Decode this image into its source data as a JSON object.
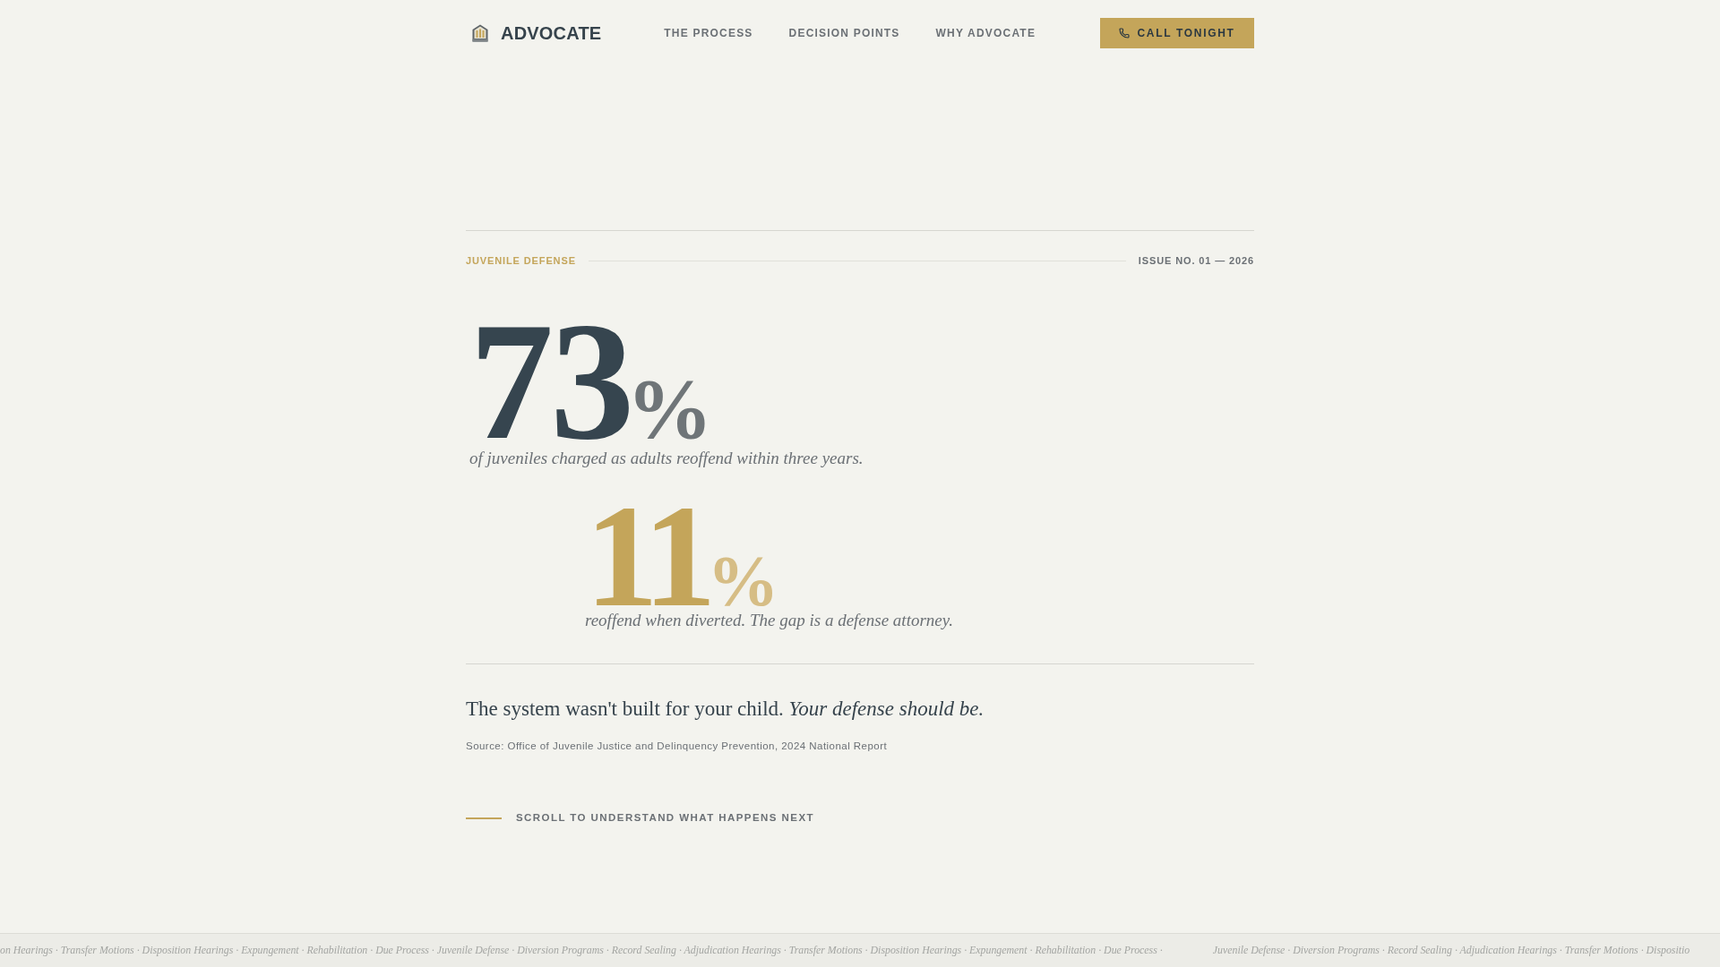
{
  "header": {
    "brand": "ADVOCATE",
    "nav": [
      "THE PROCESS",
      "DECISION POINTS",
      "WHY ADVOCATE"
    ],
    "cta": "CALL TONIGHT"
  },
  "eyebrow": {
    "label": "JUVENILE DEFENSE",
    "issue": "ISSUE NO. 01 — 2026"
  },
  "stats": [
    {
      "kind": "primary",
      "value": "73",
      "unit": "%",
      "caption": "of juveniles charged as adults reoffend within three years."
    },
    {
      "kind": "accent",
      "value": "11",
      "unit": "%",
      "caption": "reoffend when diverted. The gap is a defense attorney."
    }
  ],
  "statement": "The system wasn't built for your child. *Your defense should be.*",
  "source": "Source: Office of Juvenile Justice and Delinquency Prevention, 2024 National Report",
  "scroll_cue": "SCROLL TO UNDERSTAND WHAT HAPPENS NEXT",
  "ticker": [
    "on Hearings · Transfer Motions · Disposition Hearings · Expungement · Rehabilitation · Due Process · Juvenile Defense · Diversion Programs · Record Sealing · Adjudication Hearings · Transfer Motions · Disposition Hearings · Expungement · Rehabilitation · Due Process ·",
    "Juvenile Defense · Diversion Programs · Record Sealing · Adjudication Hearings · Transfer Motions · Dispositio"
  ]
}
